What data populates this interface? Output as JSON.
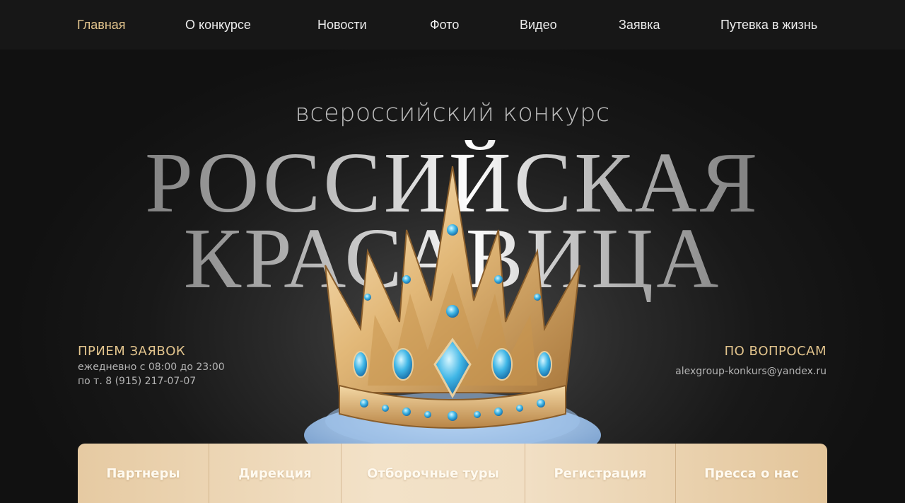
{
  "nav": {
    "items": [
      {
        "label": "Главная",
        "active": true
      },
      {
        "label": "О конкурсе"
      },
      {
        "label": "Новости"
      },
      {
        "label": "Фото"
      },
      {
        "label": "Видео"
      },
      {
        "label": "Заявка"
      },
      {
        "label": "Путевка в жизнь"
      }
    ]
  },
  "hero": {
    "subtitle": "всероссийский конкурс",
    "title_line1": "РОССИЙСКАЯ",
    "title_line2": "КРАСАВИЦА",
    "crown_icon": "crown-icon"
  },
  "applications": {
    "heading": "ПРИЕМ ЗАЯВОК",
    "line1": "ежедневно с 08:00 до 23:00",
    "line2": "по т. 8 (915) 217-07-07"
  },
  "questions": {
    "heading": "ПО ВОПРОСАМ",
    "email": "alexgroup-konkurs@yandex.ru"
  },
  "bottom_menu": {
    "items": [
      {
        "label": "Партнеры"
      },
      {
        "label": "Дирекция"
      },
      {
        "label": "Отборочные туры"
      },
      {
        "label": "Регистрация"
      },
      {
        "label": "Пресса о нас"
      }
    ]
  },
  "colors": {
    "accent_gold": "#e2c48d",
    "background": "#141414",
    "gem_blue": "#3fb6e6"
  }
}
